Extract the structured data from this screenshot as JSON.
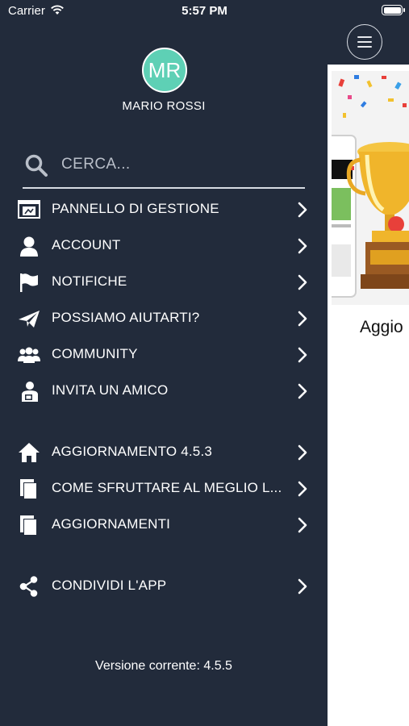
{
  "status_bar": {
    "carrier": "Carrier",
    "time": "5:57 PM"
  },
  "profile": {
    "initials": "MR",
    "name": "MARIO ROSSI",
    "avatar_color": "#5ed0b5"
  },
  "search": {
    "placeholder": "CERCA..."
  },
  "menu": {
    "items": [
      {
        "label": "PANNELLO DI GESTIONE",
        "icon": "dashboard-icon"
      },
      {
        "label": "ACCOUNT",
        "icon": "user-icon"
      },
      {
        "label": "NOTIFICHE",
        "icon": "flag-icon"
      },
      {
        "label": "POSSIAMO AIUTARTI?",
        "icon": "paper-plane-icon"
      },
      {
        "label": "COMMUNITY",
        "icon": "group-icon"
      },
      {
        "label": "INVITA UN AMICO",
        "icon": "invite-icon"
      },
      {
        "label": "AGGIORNAMENTO 4.5.3",
        "icon": "home-icon"
      },
      {
        "label": "COME SFRUTTARE AL MEGLIO L...",
        "icon": "pages-icon"
      },
      {
        "label": "AGGIORNAMENTI",
        "icon": "pages-icon"
      },
      {
        "label": "CONDIVIDI L'APP",
        "icon": "share-icon"
      }
    ]
  },
  "footer": {
    "version": "Versione corrente: 4.5.5"
  },
  "content": {
    "caption": "Aggio"
  },
  "colors": {
    "drawer_bg": "#222b3b",
    "accent": "#5ed0b5",
    "content_bg": "#ffffff"
  }
}
